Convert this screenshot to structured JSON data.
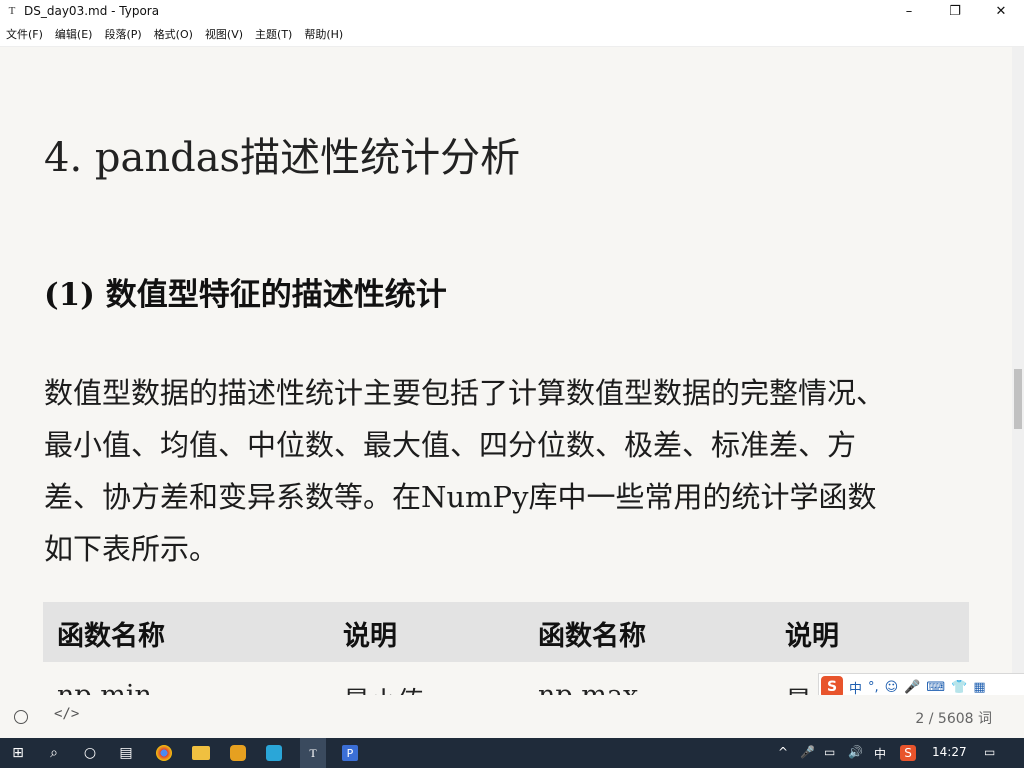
{
  "window": {
    "title": "DS_day03.md - Typora",
    "app_icon": "T",
    "minimize": "–",
    "maximize": "❐",
    "close": "✕"
  },
  "menu": [
    "文件(F)",
    "编辑(E)",
    "段落(P)",
    "格式(O)",
    "视图(V)",
    "主题(T)",
    "帮助(H)"
  ],
  "doc": {
    "heading1": "4. pandas描述性统计分析",
    "heading3": "(1)  数值型特征的描述性统计",
    "paragraph_lines": [
      "数值型数据的描述性统计主要包括了计算数值型数据的完整情况、",
      "最小值、均值、中位数、最大值、四分位数、极差、标准差、方",
      "差、协方差和变异系数等。在NumPy库中一些常用的统计学函数",
      "如下表所示。"
    ],
    "table": {
      "headers": [
        "函数名称",
        "说明",
        "函数名称",
        "说明"
      ],
      "row1": [
        "np.min",
        "最小值",
        "np.max",
        "最大值"
      ]
    }
  },
  "ime": {
    "logo": "S",
    "items": [
      "中",
      "°,",
      "☺",
      "🎤",
      "⌨",
      "👕",
      "▦"
    ]
  },
  "status": {
    "source_toggle": "</>",
    "word_count": "2 / 5608 词"
  },
  "taskbar": {
    "start": "⊞",
    "search": "⌕",
    "cortana": "○",
    "taskview": "▤",
    "tray_lang": "中",
    "tray_ime": "S",
    "time": "14:27",
    "notify": "▭"
  }
}
